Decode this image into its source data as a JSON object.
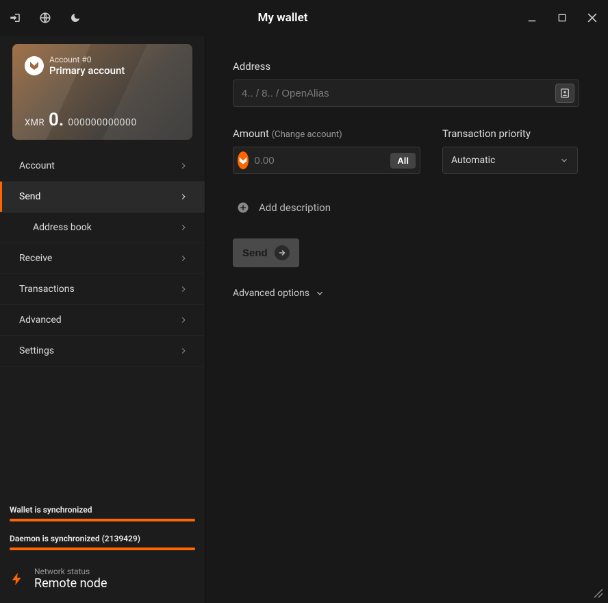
{
  "titlebar": {
    "title": "My wallet"
  },
  "account": {
    "number": "Account #0",
    "name": "Primary account",
    "currency": "XMR",
    "balance_int": "0.",
    "balance_dec": "000000000000"
  },
  "nav": {
    "account": "Account",
    "send": "Send",
    "address_book": "Address book",
    "receive": "Receive",
    "transactions": "Transactions",
    "advanced": "Advanced",
    "settings": "Settings"
  },
  "sync": {
    "wallet": "Wallet is synchronized",
    "daemon": "Daemon is synchronized (2139429)"
  },
  "network": {
    "label": "Network status",
    "value": "Remote node"
  },
  "form": {
    "address_label": "Address",
    "address_placeholder": "4.. / 8.. / OpenAlias",
    "amount_label": "Amount",
    "amount_hint": "(Change account)",
    "amount_placeholder": "0.00",
    "all_button": "All",
    "priority_label": "Transaction priority",
    "priority_value": "Automatic",
    "add_description": "Add description",
    "send_button": "Send",
    "advanced_options": "Advanced options"
  }
}
